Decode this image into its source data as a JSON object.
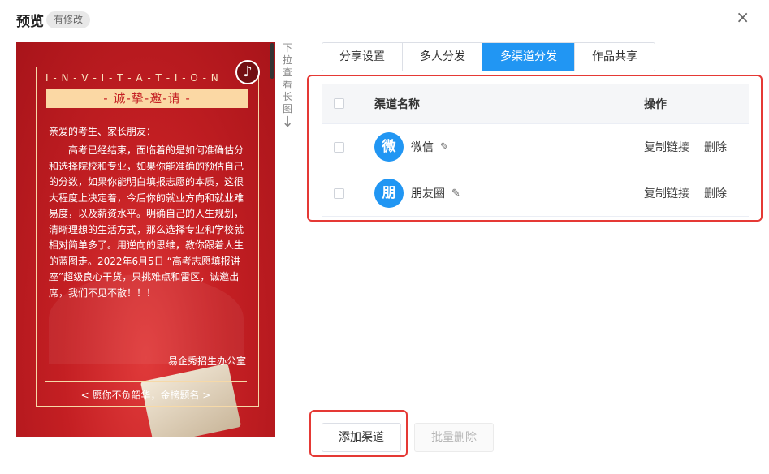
{
  "header": {
    "title": "预览",
    "badge": "有修改",
    "close_label": "×"
  },
  "card": {
    "letters": "I - N - V - I - T - A - T - I - O - N",
    "title": "- 诚-挚-邀-请 -",
    "greeting": "亲爱的考生、家长朋友：",
    "body": "高考已经结束，面临着的是如何准确估分和选择院校和专业，如果你能准确的预估自己的分数，如果你能明白填报志愿的本质，这很大程度上决定着，今后你的就业方向和就业难易度，以及薪资水平。明确自己的人生规划，清晰理想的生活方式，那么选择专业和学校就相对简单多了。用逆向的思维，教你跟着人生的蓝图走。2022年6月5日 “高考志愿填报讲座”超级良心干货，只挑难点和雷区，诚邀出席，我们不见不散！！！",
    "signature": "易企秀招生办公室",
    "footer": "< 愿你不负韶华，金榜题名 >",
    "music_icon": "♪"
  },
  "pull_hint": {
    "chars": [
      "下",
      "拉",
      "查",
      "看",
      "长",
      "图"
    ],
    "arrow": "↓"
  },
  "tabs": [
    {
      "label": "分享设置",
      "active": false
    },
    {
      "label": "多人分发",
      "active": false
    },
    {
      "label": "多渠道分发",
      "active": true
    },
    {
      "label": "作品共享",
      "active": false
    }
  ],
  "table": {
    "header_name": "渠道名称",
    "header_ops": "操作",
    "rows": [
      {
        "avatar": "微",
        "name": "微信",
        "copy": "复制链接",
        "delete": "删除"
      },
      {
        "avatar": "朋",
        "name": "朋友圈",
        "copy": "复制链接",
        "delete": "删除"
      }
    ]
  },
  "buttons": {
    "add": "添加渠道",
    "batch_delete": "批量删除"
  },
  "colors": {
    "accent": "#2196f3",
    "highlight_box": "#e53935",
    "card_red": "#c41f23"
  },
  "icons": {
    "edit": "pencil-icon",
    "music": "music-note-icon",
    "close": "close-icon"
  }
}
